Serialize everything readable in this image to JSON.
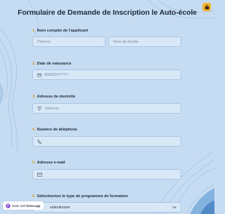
{
  "header": {
    "title": "Formulaire de Demande de Inscription le Auto-école"
  },
  "questions": [
    {
      "num": "1.",
      "label": "Nom complet de l'applicant"
    },
    {
      "num": "2.",
      "label": "Date de naissance"
    },
    {
      "num": "3.",
      "label": "Adresse de domicile"
    },
    {
      "num": "4.",
      "label": "Numéro de téléphone"
    },
    {
      "num": "5.",
      "label": "Adresse e-mail"
    },
    {
      "num": "6.",
      "label": "Sélectionnez le type de programme de formation"
    }
  ],
  "fields": {
    "first_name_placeholder": "Prénom",
    "last_name_placeholder": "Nom de famille",
    "date_placeholder": "MM/DD/YYYY",
    "address_placeholder": "Adresse",
    "phone_placeholder": "",
    "email_placeholder": "",
    "select_value": "sélectionner"
  },
  "badge": {
    "prefix": "Made with ",
    "brand": "forms.app"
  },
  "colors": {
    "background": "#c6dcf2",
    "accent": "#d79b28",
    "field_bg": "#d8e8f7",
    "field_border": "#a9c6e4"
  },
  "icons": {
    "corner": "app-icon",
    "date": "calendar-icon",
    "address": "location-pin-icon",
    "phone": "phone-icon",
    "email": "envelope-icon",
    "select": "chevron-down-icon",
    "badge": "forms-app-logo-icon"
  }
}
